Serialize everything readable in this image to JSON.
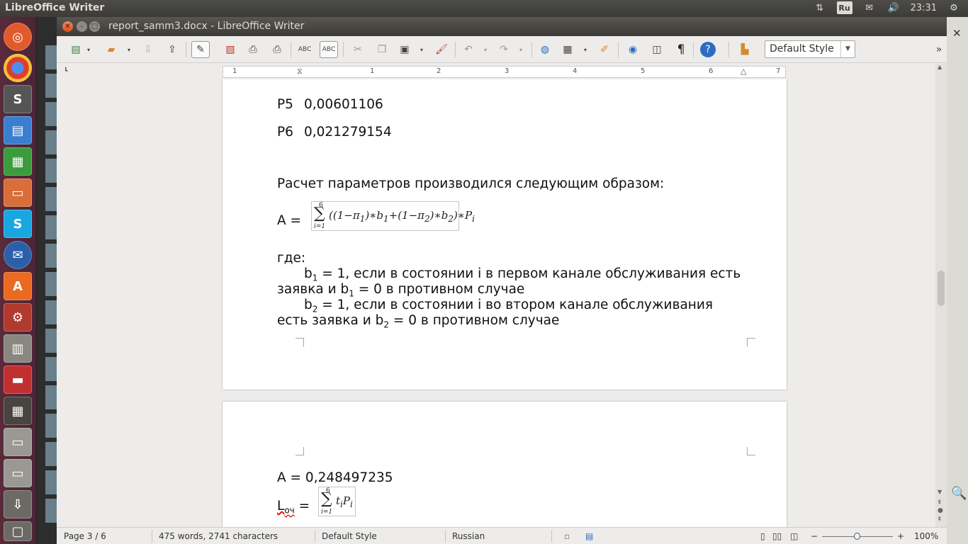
{
  "topbar": {
    "app_title": "LibreOffice Writer",
    "keyboard_layout": "Ru",
    "clock": "23:31"
  },
  "window": {
    "title": "report_samm3.docx - LibreOffice Writer"
  },
  "toolbar": {
    "style_box": "Default Style",
    "pilcrow": "¶"
  },
  "ruler": {
    "labels": [
      "1",
      "1",
      "2",
      "3",
      "4",
      "5",
      "6",
      "7"
    ]
  },
  "document": {
    "p5_label": "P5",
    "p5_value": "0,00601106",
    "p6_label": "P6",
    "p6_value": "0,021279154",
    "intro": "Расчет параметров производился следующим образом:",
    "a_label": "A =",
    "where": "где:",
    "b1_line1_a": "b",
    "b1_sub": "1",
    "b1_line1_b": " = 1, если в состоянии i в первом канале обслуживания есть",
    "b1_line2_a": "заявка и b",
    "b1_line2_sub": "1",
    "b1_line2_b": " = 0 в противном случае",
    "b2_line1_a": "b",
    "b2_sub": "2",
    "b2_line1_b": " = 1, если в состоянии i во втором канале обслуживания",
    "b2_line2_a": "есть заявка и b",
    "b2_line2_sub": "2",
    "b2_line2_b": " = 0 в противном случае",
    "a_result": "A = 0,248497235",
    "loch_label": "L",
    "loch_sub": "оч",
    "loch_eq": " ="
  },
  "formula_a": {
    "sum_top": "6",
    "sum_bottom": "i=1",
    "body": "((1−π",
    "sub1": "1",
    "mid1": ")∗b",
    "sub_b1": "1",
    "plus": "+(1−π",
    "sub2": "2",
    "mid2": ")∗b",
    "sub_b2": "2",
    "end": ")∗P",
    "sub_i": "i"
  },
  "formula_l": {
    "sum_top": "6",
    "sum_bottom": "i=1",
    "t": "t",
    "ti": "i",
    "p": "P",
    "pi": "i"
  },
  "status": {
    "page": "Page 3 / 6",
    "words": "475 words, 2741 characters",
    "style": "Default Style",
    "language": "Russian",
    "zoom": "100%"
  }
}
